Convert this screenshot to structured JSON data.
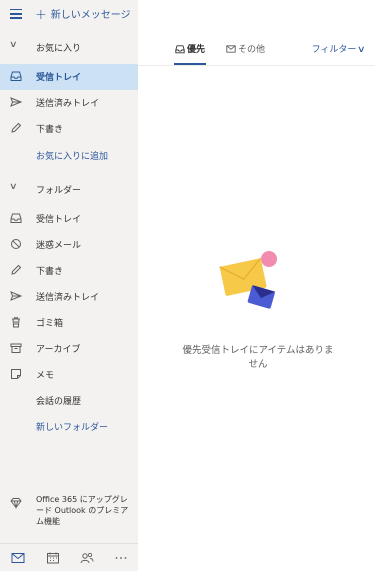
{
  "toolbar": {
    "new_message": "新しいメッセージ"
  },
  "favorites": {
    "header": "お気に入り",
    "items": [
      {
        "label": "受信トレイ",
        "icon": "inbox-icon"
      },
      {
        "label": "送信済みトレイ",
        "icon": "sent-icon"
      },
      {
        "label": "下書き",
        "icon": "pencil-icon"
      }
    ],
    "add_link": "お気に入りに追加"
  },
  "folders": {
    "header": "フォルダー",
    "items": [
      {
        "label": "受信トレイ",
        "icon": "inbox-icon"
      },
      {
        "label": "迷惑メール",
        "icon": "block-icon"
      },
      {
        "label": "下書き",
        "icon": "pencil-icon"
      },
      {
        "label": "送信済みトレイ",
        "icon": "sent-icon"
      },
      {
        "label": "ゴミ箱",
        "icon": "trash-icon"
      },
      {
        "label": "アーカイブ",
        "icon": "archive-icon"
      },
      {
        "label": "メモ",
        "icon": "note-icon"
      },
      {
        "label": "会話の履歴",
        "icon": ""
      }
    ],
    "new_folder": "新しいフォルダー"
  },
  "promo": {
    "text": "Office 365 にアップグレード Outlook のプレミアム機能"
  },
  "tabs": {
    "focused": "優先",
    "other": "その他"
  },
  "filter": {
    "label": "フィルター"
  },
  "empty": {
    "message": "優先受信トレイにアイテムはありません"
  },
  "colors": {
    "accent": "#2b579a",
    "selected_bg": "#cce1f4",
    "sidebar_bg": "#f3f2f1"
  }
}
